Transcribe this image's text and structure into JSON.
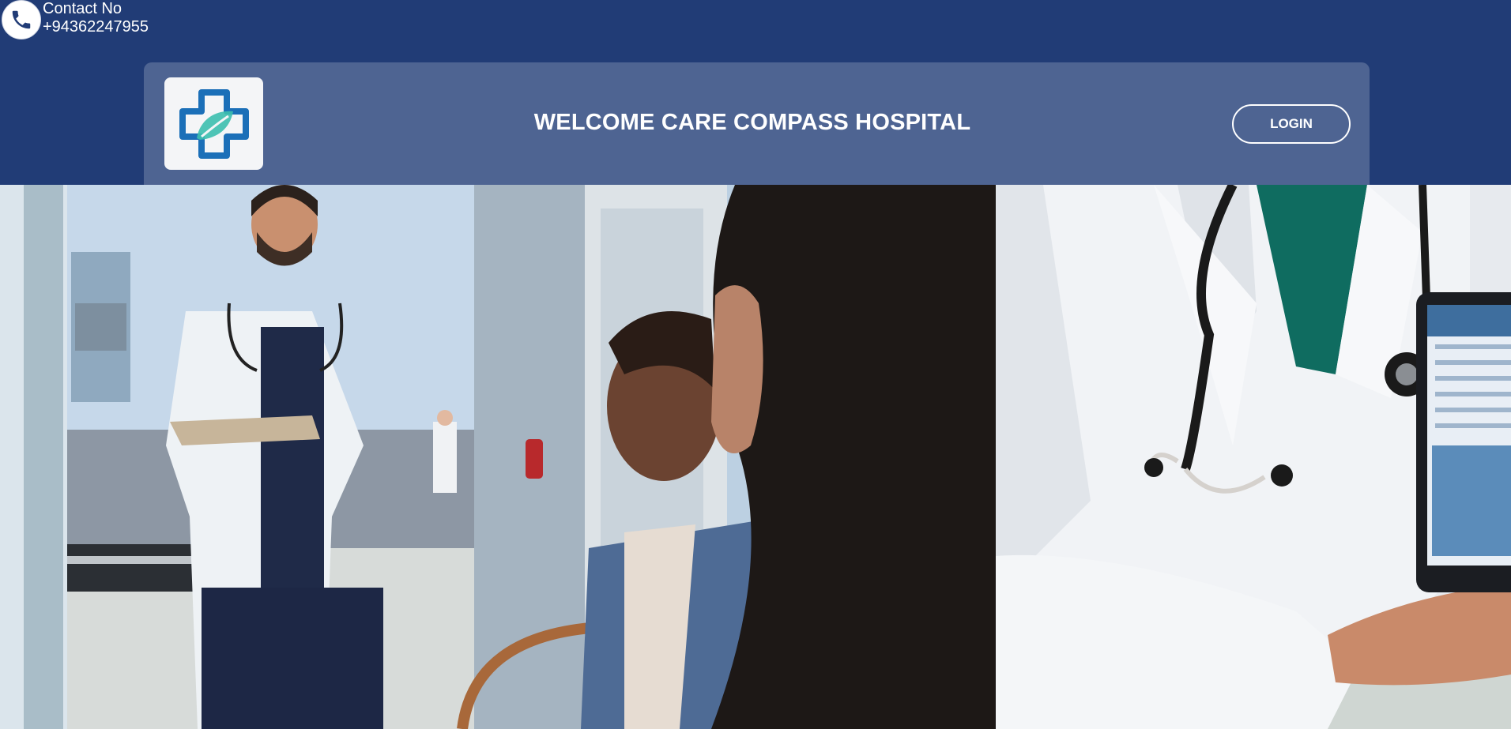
{
  "contact": {
    "label": "Contact No",
    "number": "+94362247955",
    "icon": "phone-icon"
  },
  "header": {
    "title": "WELCOME CARE COMPASS HOSPITAL",
    "login_label": "LOGIN",
    "logo_icon": "medical-cross-leaf-logo"
  },
  "hero": {
    "left_image": "doctor-with-clipboard-and-patients-photo",
    "right_image": "doctor-with-tablet-photo"
  },
  "colors": {
    "topbar": "#213c76",
    "header_card": "#4e6492",
    "logo_blue": "#1b6fb8",
    "logo_teal": "#3cbfae"
  }
}
